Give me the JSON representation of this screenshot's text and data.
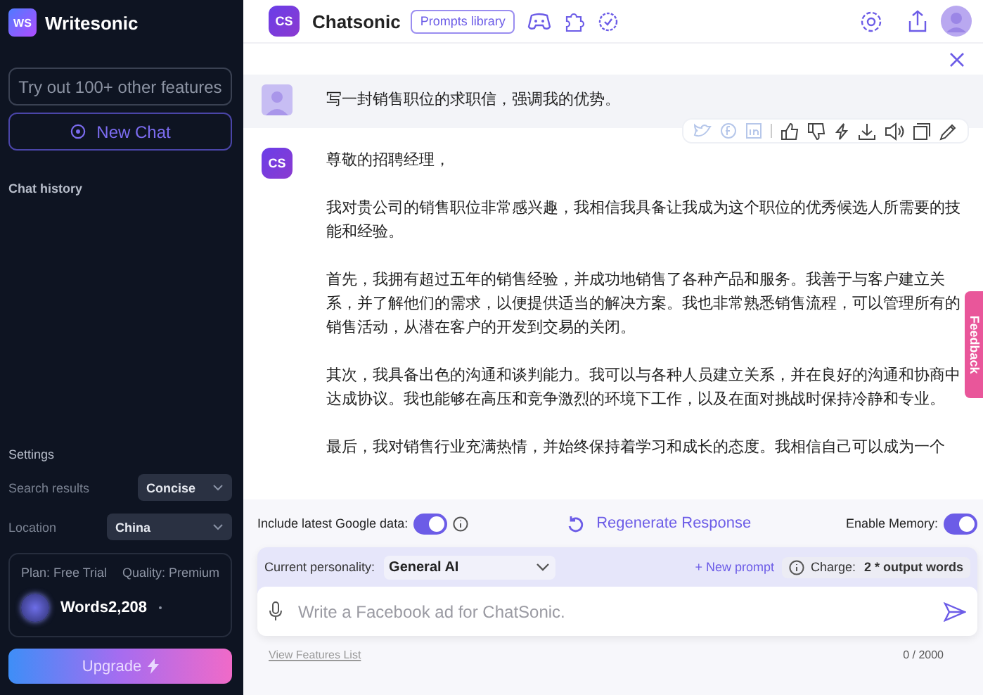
{
  "sidebar": {
    "brand": {
      "logo": "WS",
      "name": "Writesonic"
    },
    "features_button": "Try out 100+ other features",
    "new_chat_button": "New Chat",
    "chat_history_heading": "Chat history",
    "settings": {
      "heading": "Settings",
      "fields": [
        {
          "label": "Search results",
          "value": "Concise"
        },
        {
          "label": "Location",
          "value": "China"
        }
      ]
    },
    "plan": {
      "plan": "Plan: Free Trial",
      "quality": "Quality: Premium",
      "words": "Words2,208"
    },
    "upgrade_button": "Upgrade"
  },
  "header": {
    "logo": "CS",
    "title": "Chatsonic",
    "prompts_library_button": "Prompts library"
  },
  "messages": [
    {
      "kind": "user",
      "paragraphs": [
        "写一封销售职位的求职信，强调我的优势。"
      ]
    },
    {
      "kind": "assistant",
      "avatar": "CS",
      "paragraphs": [
        "尊敬的招聘经理，",
        "我对贵公司的销售职位非常感兴趣，我相信我具备让我成为这个职位的优秀候选人所需要的技能和经验。",
        "首先，我拥有超过五年的销售经验，并成功地销售了各种产品和服务。我善于与客户建立关系，并了解他们的需求，以便提供适当的解决方案。我也非常熟悉销售流程，可以管理所有的销售活动，从潜在客户的开发到交易的关闭。",
        "其次，我具备出色的沟通和谈判能力。我可以与各种人员建立关系，并在良好的沟通和协商中达成协议。我也能够在高压和竞争激烈的环境下工作，以及在面对挑战时保持冷静和专业。",
        "最后，我对销售行业充满热情，并始终保持着学习和成长的态度。我相信自己可以成为一个"
      ]
    }
  ],
  "feedback_tab": "Feedback",
  "composer": {
    "google_data": {
      "label": "Include latest Google data:",
      "on": true
    },
    "regenerate_button": "Regenerate Response",
    "memory": {
      "label": "Enable Memory:",
      "on": true
    },
    "personality": {
      "label": "Current personality:",
      "value": "General AI"
    },
    "new_prompt_link": "+ New prompt",
    "charge": {
      "label": "Charge:",
      "value": "2 * output words"
    },
    "input": {
      "placeholder": "Write a Facebook ad for ChatSonic."
    },
    "features_link": "View Features List",
    "counter": "0 / 2000"
  }
}
